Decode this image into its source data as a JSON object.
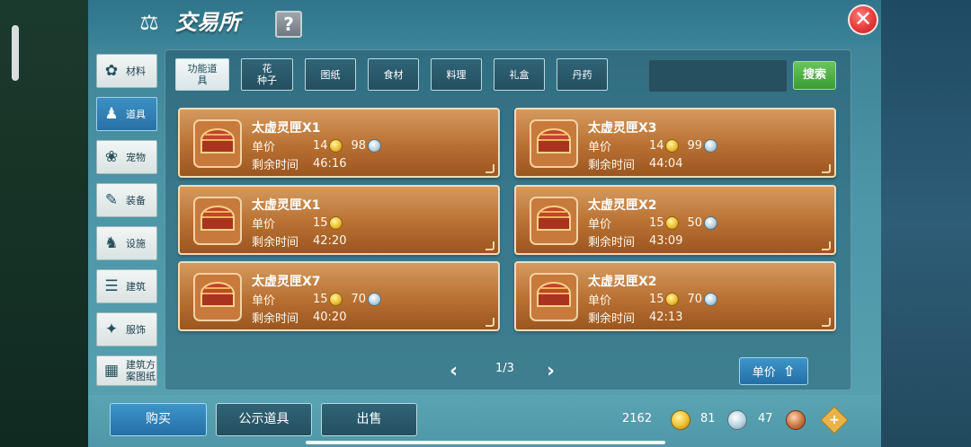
{
  "header": {
    "title": "交易所",
    "help_label": "?",
    "close_label": "✕"
  },
  "sidebar": {
    "items": [
      {
        "label": "材料",
        "icon": "materials-icon",
        "glyph": "✿"
      },
      {
        "label": "道具",
        "icon": "tools-icon",
        "glyph": "♟",
        "active": true
      },
      {
        "label": "宠物",
        "icon": "paw-icon",
        "glyph": "❀"
      },
      {
        "label": "装备",
        "icon": "equipment-icon",
        "glyph": "✎"
      },
      {
        "label": "设施",
        "icon": "facility-icon",
        "glyph": "♞"
      },
      {
        "label": "建筑",
        "icon": "building-icon",
        "glyph": "☰"
      },
      {
        "label": "服饰",
        "icon": "clothing-icon",
        "glyph": "✦"
      },
      {
        "label": "建筑方案图纸",
        "label_line1": "建筑方",
        "label_line2": "案图纸",
        "icon": "blueprint-icon",
        "glyph": "▦"
      }
    ]
  },
  "tabs": [
    {
      "line1": "功能道",
      "line2": "具",
      "active": true
    },
    {
      "line1": "花",
      "line2": "种子"
    },
    {
      "line1": "图纸",
      "line2": ""
    },
    {
      "line1": "食材",
      "line2": ""
    },
    {
      "line1": "料理",
      "line2": ""
    },
    {
      "line1": "礼盒",
      "line2": ""
    },
    {
      "line1": "丹药",
      "line2": ""
    }
  ],
  "search": {
    "button_label": "搜索"
  },
  "listings": [
    {
      "name": "太虚灵匣X1",
      "price_label": "单价",
      "gold": "14",
      "silver": "98",
      "time_label": "剩余时间",
      "time": "46:16"
    },
    {
      "name": "太虚灵匣X3",
      "price_label": "单价",
      "gold": "14",
      "silver": "99",
      "time_label": "剩余时间",
      "time": "44:04"
    },
    {
      "name": "太虚灵匣X1",
      "price_label": "单价",
      "gold": "15",
      "silver": "",
      "time_label": "剩余时间",
      "time": "42:20"
    },
    {
      "name": "太虚灵匣X2",
      "price_label": "单价",
      "gold": "15",
      "silver": "50",
      "time_label": "剩余时间",
      "time": "43:09"
    },
    {
      "name": "太虚灵匣X7",
      "price_label": "单价",
      "gold": "15",
      "silver": "70",
      "time_label": "剩余时间",
      "time": "40:20"
    },
    {
      "name": "太虚灵匣X2",
      "price_label": "单价",
      "gold": "15",
      "silver": "70",
      "time_label": "剩余时间",
      "time": "42:13"
    }
  ],
  "pagination": {
    "text": "1/3"
  },
  "sort": {
    "label": "单价"
  },
  "bottom": {
    "buy_label": "购买",
    "public_label": "公示道具",
    "sell_label": "出售"
  },
  "currency": {
    "gold": "2162",
    "silver": "81",
    "copper": "47"
  },
  "colors": {
    "card": "#b87032",
    "active_blue": "#2871a6",
    "search_green": "#3a9b34"
  }
}
